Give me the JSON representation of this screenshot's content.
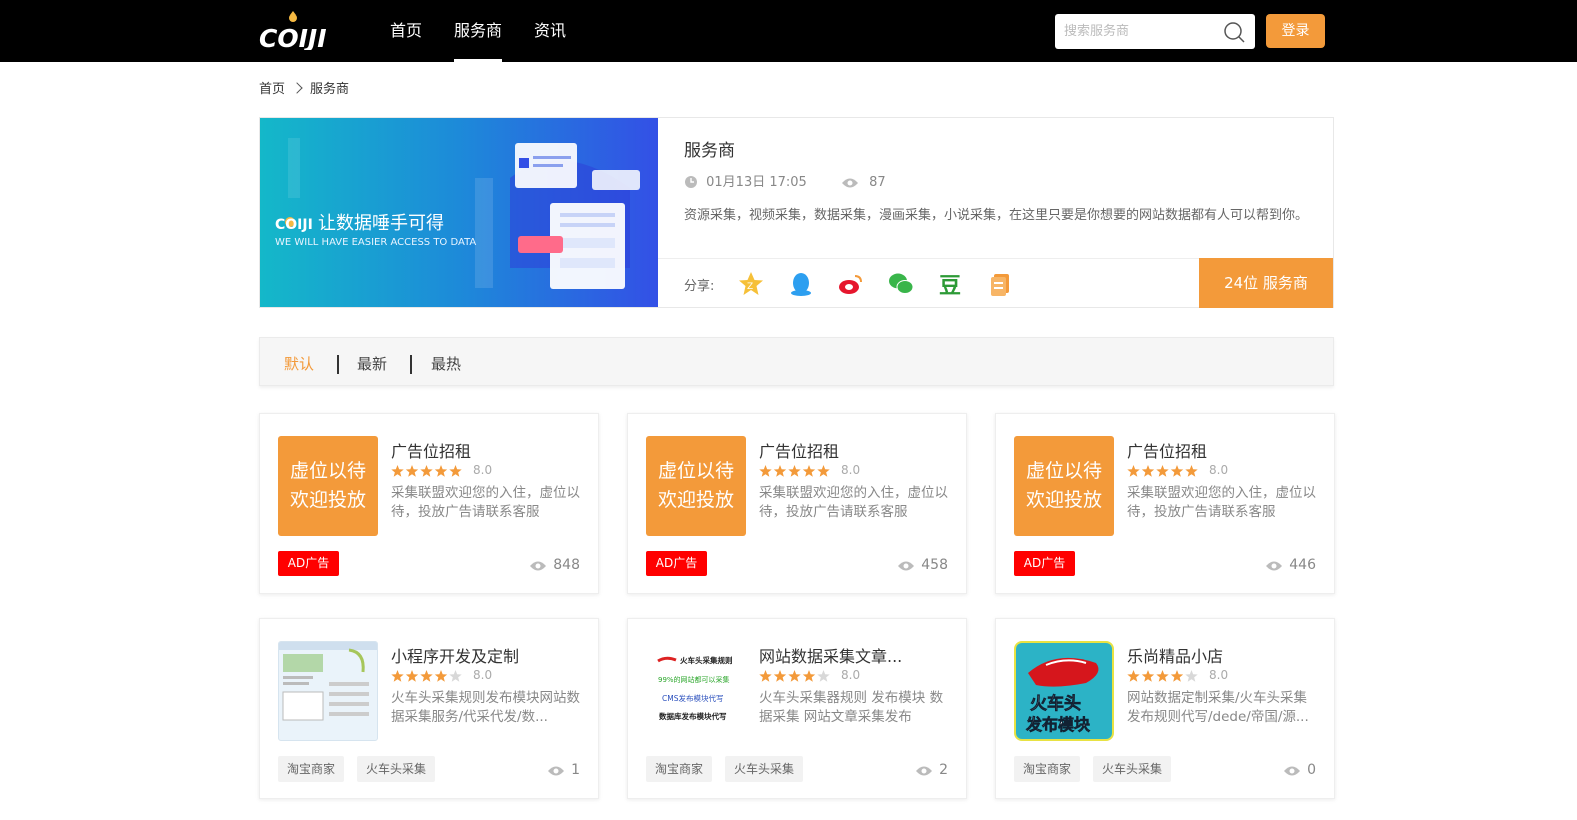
{
  "header": {
    "logo_text": "COIJI",
    "nav": [
      "首页",
      "服务商",
      "资讯"
    ],
    "search_placeholder": "搜索服务商",
    "login_label": "登录"
  },
  "breadcrumb": [
    "首页",
    "服务商"
  ],
  "hero": {
    "banner_title": "让数据唾手可得",
    "banner_subtitle": "WE WILL HAVE EASIER ACCESS TO DATA",
    "title": "服务商",
    "date": "01月13日 17:05",
    "views": "87",
    "description": "资源采集，视频采集，数据采集，漫画采集，小说采集，在这里只要是你想要的网站数据都有人可以帮到你。",
    "share_label": "分享:",
    "share_icons": [
      "qzone-icon",
      "qq-icon",
      "weibo-icon",
      "wechat-icon",
      "douban-icon",
      "copy-icon"
    ],
    "count_label": "24位 服务商"
  },
  "filters": [
    "默认",
    "最新",
    "最热"
  ],
  "active_filter": "默认",
  "cards": [
    {
      "title": "广告位招租",
      "score": "8.0",
      "stars": 5,
      "desc": "采集联盟欢迎您的入住，虚位以待，投放广告请联系客服",
      "thumb_text": [
        "虚位以待",
        "欢迎投放"
      ],
      "ad": "AD广告",
      "views": "848"
    },
    {
      "title": "广告位招租",
      "score": "8.0",
      "stars": 5,
      "desc": "采集联盟欢迎您的入住，虚位以待，投放广告请联系客服",
      "thumb_text": [
        "虚位以待",
        "欢迎投放"
      ],
      "ad": "AD广告",
      "views": "458"
    },
    {
      "title": "广告位招租",
      "score": "8.0",
      "stars": 5,
      "desc": "采集联盟欢迎您的入住，虚位以待，投放广告请联系客服",
      "thumb_text": [
        "虚位以待",
        "欢迎投放"
      ],
      "ad": "AD广告",
      "views": "446"
    },
    {
      "title": "小程序开发及定制",
      "score": "8.0",
      "stars": 4,
      "desc": "火车头采集规则发布模块网站数据采集服务/代采代发/数...",
      "tags": [
        "淘宝商家",
        "火车头采集"
      ],
      "views": "1"
    },
    {
      "title": "网站数据采集文章...",
      "score": "8.0",
      "stars": 4,
      "desc": "火车头采集器规则 发布模块 数据采集 网站文章采集发布",
      "thumb_lines": [
        "火车头采集规则",
        "99%的网站都可以采集",
        "CMS发布模块代写",
        "数据库发布模块代写"
      ],
      "tags": [
        "淘宝商家",
        "火车头采集"
      ],
      "views": "2"
    },
    {
      "title": "乐尚精品小店",
      "score": "8.0",
      "stars": 4,
      "desc": "网站数据定制采集/火车头采集发布规则代写/dede/帝国/源...",
      "thumb_text": [
        "火车头",
        "发布模块"
      ],
      "tags": [
        "淘宝商家",
        "火车头采集"
      ],
      "views": "0"
    }
  ]
}
